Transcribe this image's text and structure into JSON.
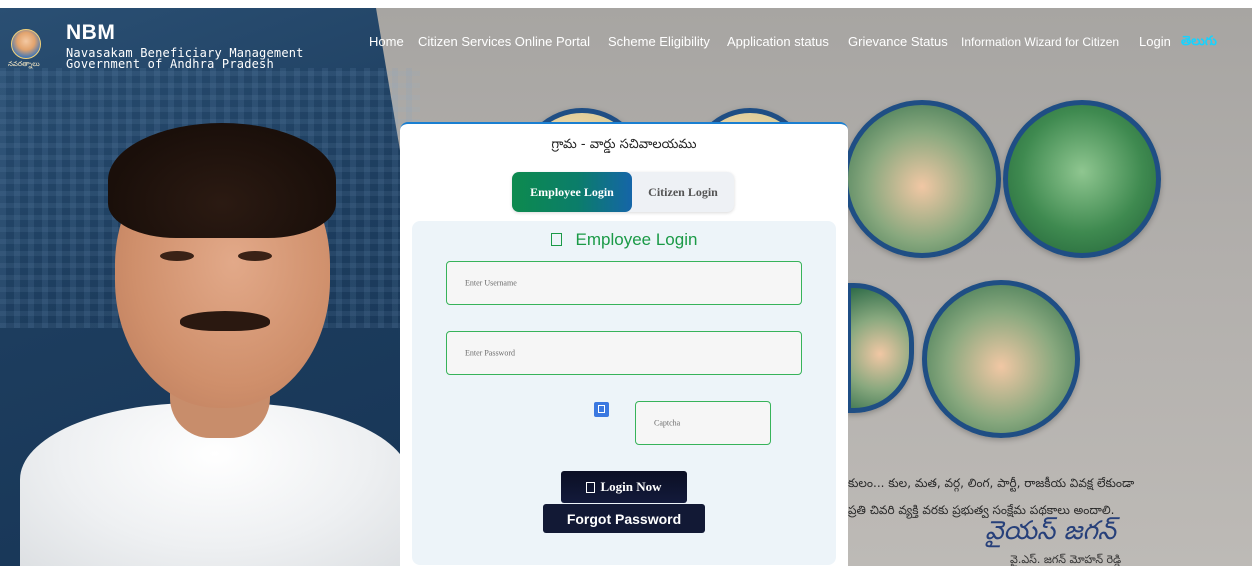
{
  "brand": {
    "title": "NBM",
    "subtitle_line1": "Navasakam Beneficiary Management",
    "subtitle_line2": "Government of Andhra Pradesh",
    "logo_caption": "నవరత్నాలు"
  },
  "nav": {
    "items": [
      {
        "label": "Home"
      },
      {
        "label": "Citizen Services Online Portal"
      },
      {
        "label": "Scheme Eligibility"
      },
      {
        "label": "Application status"
      },
      {
        "label": "Grievance Status"
      },
      {
        "label": "Information Wizard for Citizen"
      },
      {
        "label": "Login"
      },
      {
        "label": "తెలుగు"
      }
    ]
  },
  "card": {
    "header": "గ్రామ - వార్డు సచివాలయము",
    "tabs": {
      "employee": "Employee Login",
      "citizen": "Citizen Login"
    },
    "panel_title": "Employee Login",
    "username_placeholder": "Enter Username",
    "password_placeholder": "Enter Password",
    "captcha_placeholder": "Captcha",
    "login_button": "Login Now",
    "forgot_button": "Forgot Password"
  },
  "background": {
    "quote_line1": "కులం... కుల, మత, వర్గ, లింగ, పార్టీ, రాజకీయ వివక్ష లేకుండా",
    "quote_line2": "ప్రతి చివరి వ్యక్తి వరకు ప్రభుత్వ సంక్షేమ పథకాలు అందాలి.",
    "signature": "వైయస్ జగన్",
    "signature_name": "వై.ఎస్. జగన్ మోహన్ రెడ్డి"
  },
  "colors": {
    "accent_green": "#1b9a47",
    "header_blue": "#1d3d5e",
    "button_dark": "#121935",
    "telugu_link": "#17d3ff"
  },
  "icons": {
    "panel_title_icon": "user-icon",
    "login_icon": "sign-in-icon",
    "captcha_icon": "refresh-icon"
  }
}
